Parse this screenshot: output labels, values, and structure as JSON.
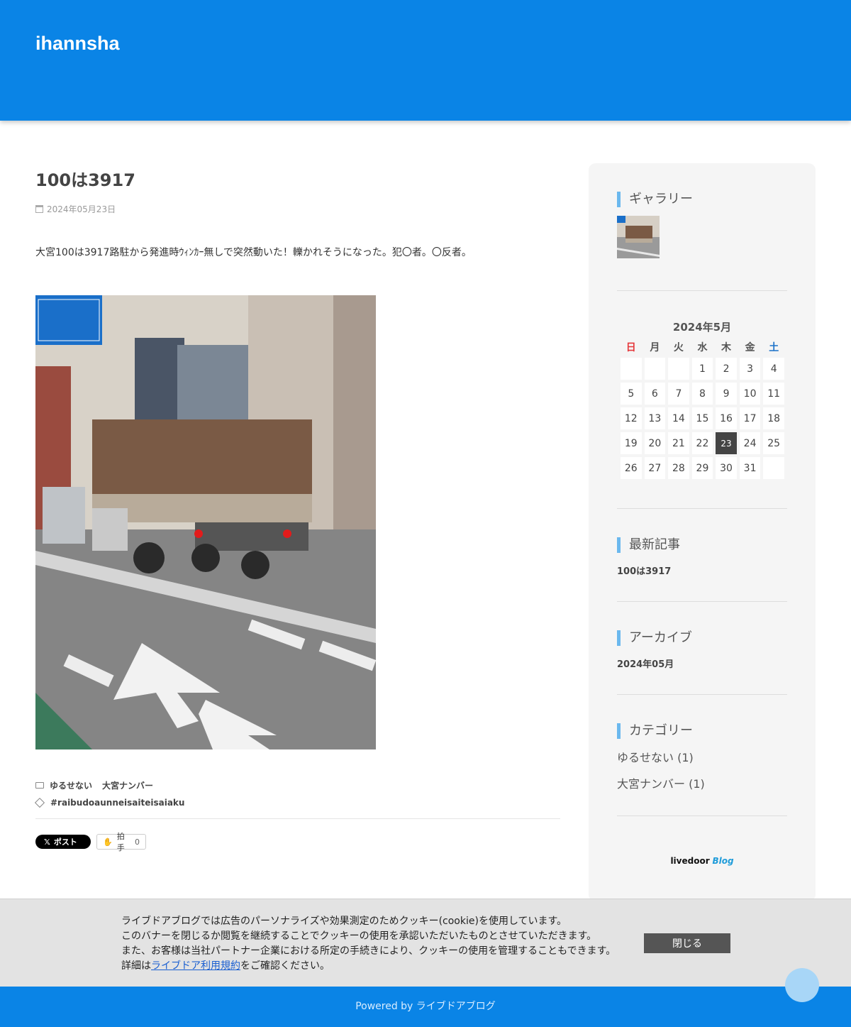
{
  "header": {
    "site_title": "ihannsha"
  },
  "article": {
    "title": "100は3917",
    "date": "2024年05月23日",
    "body": "大宮100は3917路駐から発進時ｳｨﾝｶｰ無しで突然動いた！轢かれそうになった。犯〇者。〇反者。",
    "categories": [
      "ゆるせない",
      "大宮ナンバー"
    ],
    "tags": [
      "#raibudoaunneisaiteisaiaku"
    ],
    "share": {
      "x_label": "ポスト",
      "clap_label": "拍手",
      "clap_count": "0"
    }
  },
  "sidebar": {
    "gallery": {
      "title": "ギャラリー"
    },
    "calendar": {
      "title": "2024年5月",
      "weekdays": [
        "日",
        "月",
        "火",
        "水",
        "木",
        "金",
        "土"
      ],
      "weeks": [
        [
          "",
          "",
          "",
          "1",
          "2",
          "3",
          "4"
        ],
        [
          "5",
          "6",
          "7",
          "8",
          "9",
          "10",
          "11"
        ],
        [
          "12",
          "13",
          "14",
          "15",
          "16",
          "17",
          "18"
        ],
        [
          "19",
          "20",
          "21",
          "22",
          "23",
          "24",
          "25"
        ],
        [
          "26",
          "27",
          "28",
          "29",
          "30",
          "31",
          ""
        ]
      ],
      "today": "23"
    },
    "recent": {
      "title": "最新記事",
      "items": [
        "100は3917"
      ]
    },
    "archive": {
      "title": "アーカイブ",
      "items": [
        "2024年05月"
      ]
    },
    "category": {
      "title": "カテゴリー",
      "items": [
        "ゆるせない (1)",
        "大宮ナンバー (1)"
      ]
    },
    "logo": {
      "livedoor": "livedoor",
      "blog": "Blog"
    }
  },
  "cookie": {
    "line1": "ライブドアブログでは広告のパーソナライズや効果測定のためクッキー(cookie)を使用しています。",
    "line2": "このバナーを閉じるか閲覧を継続することでクッキーの使用を承認いただいたものとさせていただきます。",
    "line3": "また、お客様は当社パートナー企業における所定の手続きにより、クッキーの使用を管理することもできます。",
    "line4_prefix": "詳細は",
    "line4_link": "ライブドア利用規約",
    "line4_suffix": "をご確認ください。",
    "close_label": "閉じる"
  },
  "footer": {
    "text": "Powered by ライブドアブログ"
  },
  "colors": {
    "brand": "#0a84e6",
    "accent": "#6bb8ee",
    "today": "#444444"
  }
}
